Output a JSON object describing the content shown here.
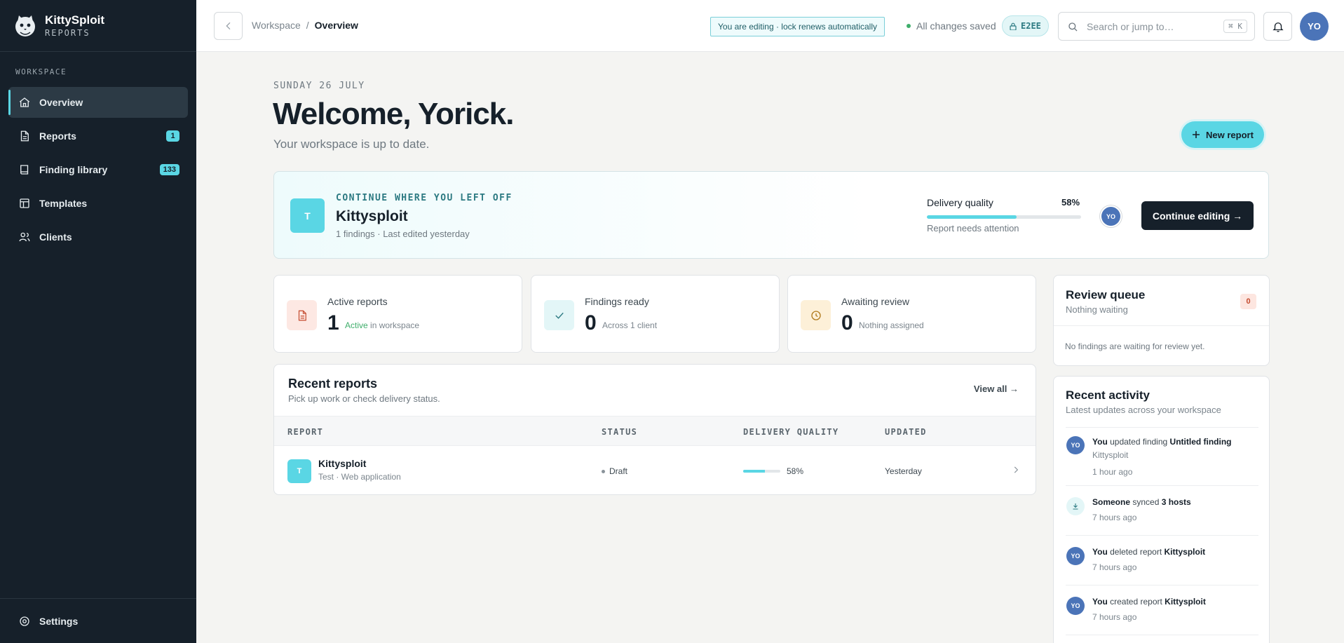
{
  "brand": {
    "name": "KittySploit",
    "sub": "REPORTS"
  },
  "sidebar": {
    "section": "WORKSPACE",
    "items": [
      {
        "label": "Overview",
        "icon": "home-icon",
        "active": true
      },
      {
        "label": "Reports",
        "icon": "file-icon",
        "badge": "1"
      },
      {
        "label": "Finding library",
        "icon": "book-icon",
        "badge": "133"
      },
      {
        "label": "Templates",
        "icon": "layout-icon"
      },
      {
        "label": "Clients",
        "icon": "users-icon"
      }
    ],
    "footer": {
      "label": "Settings",
      "icon": "gear-icon"
    }
  },
  "topbar": {
    "breadcrumb": {
      "parent": "Workspace",
      "separator": "/",
      "current": "Overview"
    },
    "lock_note": "You are editing · lock renews automatically",
    "saved": "All changes saved",
    "e2ee": "E2EE",
    "search_placeholder": "Search or jump to…",
    "search_shortcut": "⌘ K",
    "user_initials": "YO"
  },
  "main": {
    "date": "SUNDAY 26 JULY",
    "welcome": "Welcome, Yorick.",
    "subtitle": "Your workspace is up to date.",
    "new_report": "New report"
  },
  "continue": {
    "avatar": "T",
    "kicker": "CONTINUE WHERE YOU LEFT OFF",
    "title": "Kittysploit",
    "meta": "1 findings · Last edited yesterday",
    "quality_label": "Delivery quality",
    "quality_pct": "58%",
    "quality_value": 0.58,
    "quality_note": "Report needs attention",
    "user_initials": "YO",
    "button": "Continue editing →"
  },
  "stats": [
    {
      "label": "Active reports",
      "value": "1",
      "accent": "Active",
      "sub": " in workspace",
      "icon": "document-icon"
    },
    {
      "label": "Findings ready",
      "value": "0",
      "sub": "Across 1 client",
      "icon": "check-icon"
    },
    {
      "label": "Awaiting review",
      "value": "0",
      "sub": "Nothing assigned",
      "icon": "clock-icon"
    }
  ],
  "recent": {
    "title": "Recent reports",
    "subtitle": "Pick up work or check delivery status.",
    "view_all": "View all →",
    "columns": [
      "REPORT",
      "STATUS",
      "DELIVERY QUALITY",
      "UPDATED"
    ],
    "rows": [
      {
        "avatar": "T",
        "name": "Kittysploit",
        "meta": "Test · Web application",
        "status": "Draft",
        "quality_pct": "58%",
        "quality_value": 0.58,
        "updated": "Yesterday"
      }
    ]
  },
  "queue": {
    "title": "Review queue",
    "subtitle": "Nothing waiting",
    "count": "0",
    "empty": "No findings are waiting for review yet."
  },
  "activity": {
    "title": "Recent activity",
    "subtitle": "Latest updates across your workspace",
    "items": [
      {
        "avatar": "YO",
        "actor": "You",
        "action": " updated finding ",
        "target": "Untitled finding",
        "extra": " Kittysploit",
        "time": "1 hour ago"
      },
      {
        "avatar": "sync",
        "actor": "Someone",
        "action": " synced ",
        "target": "3 hosts",
        "extra": "",
        "time": "7 hours ago"
      },
      {
        "avatar": "YO",
        "actor": "You",
        "action": " deleted report ",
        "target": "Kittysploit",
        "extra": "",
        "time": "7 hours ago"
      },
      {
        "avatar": "YO",
        "actor": "You",
        "action": " created report ",
        "target": "Kittysploit",
        "extra": "",
        "time": "7 hours ago"
      }
    ]
  },
  "colors": {
    "accent": "#5ad6e4",
    "sidebar_bg": "#16202a",
    "avatar_blue": "#4b74b8",
    "success": "#3fae6b"
  }
}
